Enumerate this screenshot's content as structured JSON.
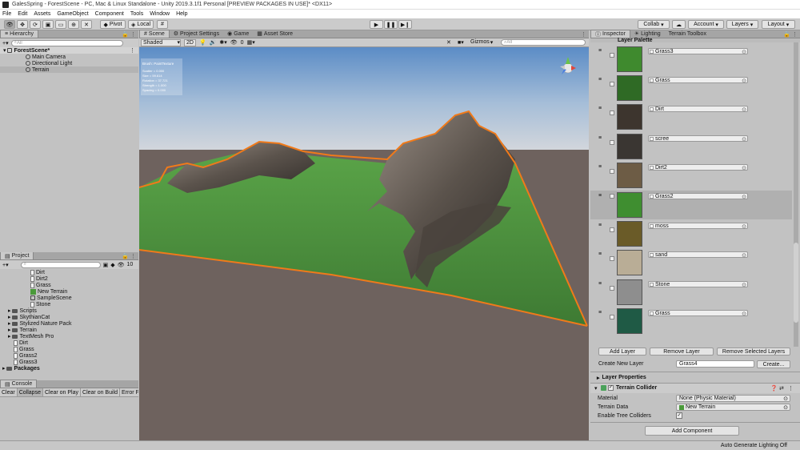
{
  "window": {
    "title": "GalesSpring - ForestScene - PC, Mac & Linux Standalone - Unity 2019.3.1f1 Personal [PREVIEW PACKAGES IN USE]* <DX11>"
  },
  "menu": [
    "File",
    "Edit",
    "Assets",
    "GameObject",
    "Component",
    "Tools",
    "Window",
    "Help"
  ],
  "toolbar": {
    "pivot": "Pivot",
    "local": "Local",
    "collab": "Collab",
    "account": "Account",
    "layers": "Layers",
    "layout": "Layout"
  },
  "hierarchy": {
    "tab": "Hierarchy",
    "search_placeholder": "All",
    "scene": "ForestScene*",
    "items": [
      "Main Camera",
      "Directional Light",
      "Terrain"
    ]
  },
  "project": {
    "tab": "Project",
    "count": "10",
    "items": [
      {
        "label": "Dirt",
        "icon": "file"
      },
      {
        "label": "Dirt2",
        "icon": "file"
      },
      {
        "label": "Grass",
        "icon": "file"
      },
      {
        "label": "New Terrain",
        "icon": "terrain"
      },
      {
        "label": "SampleScene",
        "icon": "scene"
      },
      {
        "label": "Stone",
        "icon": "file"
      }
    ],
    "folders": [
      "Scripts",
      "SkythianCat",
      "Stylized Nature Pack",
      "Terrain",
      "TextMesh Pro"
    ],
    "root_files": [
      "Dirt",
      "Grass",
      "Grass2",
      "Grass3"
    ],
    "packages": "Packages"
  },
  "console": {
    "tab": "Console",
    "buttons": [
      "Clear",
      "Collapse",
      "Clear on Play",
      "Clear on Build",
      "Error Paus"
    ]
  },
  "scene_view": {
    "tabs": [
      "Scene",
      "Project Settings",
      "Game",
      "Asset Store"
    ],
    "shading": "Shaded",
    "gizmos": "Gizmos",
    "search_placeholder": "All",
    "toggle_count": "0",
    "brush_title": "Brush: PaintTexture",
    "brush_info": [
      "Scatter = 0.000",
      "Size = 59.614",
      "Rotation = 37.721",
      "Strength = 1.000",
      "Spacing = 0.000"
    ],
    "colors": {
      "sky_top": "#5f8fc9",
      "sky_bottom": "#cfd6df",
      "ground": "#6e625e",
      "grass": "#4c8a3d",
      "outline": "#f07a1a"
    }
  },
  "inspector": {
    "tabs": [
      "Inspector",
      "Lighting",
      "Terrain Toolbox"
    ],
    "palette_title": "Layer Palette",
    "layers": [
      {
        "name": "Grass3",
        "color": "#3f8a2e"
      },
      {
        "name": "Grass",
        "color": "#2f6a25"
      },
      {
        "name": "Dirt",
        "color": "#3d352e"
      },
      {
        "name": "scree",
        "color": "#3a3632"
      },
      {
        "name": "Dirt2",
        "color": "#6d5c45"
      },
      {
        "name": "Grass2",
        "color": "#3f8e30"
      },
      {
        "name": "moss",
        "color": "#6a5b28"
      },
      {
        "name": "sand",
        "color": "#b9ad96"
      },
      {
        "name": "Stone",
        "color": "#8e8e8e"
      },
      {
        "name": "Grass",
        "color": "#1f5a45"
      }
    ],
    "add_layer": "Add Layer",
    "remove_layer": "Remove Layer",
    "remove_selected": "Remove Selected Layers",
    "create_label": "Create New Layer",
    "create_value": "Grass4",
    "create_button": "Create...",
    "layer_properties": "Layer Properties",
    "collider_title": "Terrain Collider",
    "material_label": "Material",
    "material_value": "None (Physic Material)",
    "terrain_data_label": "Terrain Data",
    "terrain_data_value": "New Terrain",
    "tree_colliders_label": "Enable Tree Colliders",
    "add_component": "Add Component"
  },
  "status": {
    "text": "Auto Generate Lighting Off"
  }
}
